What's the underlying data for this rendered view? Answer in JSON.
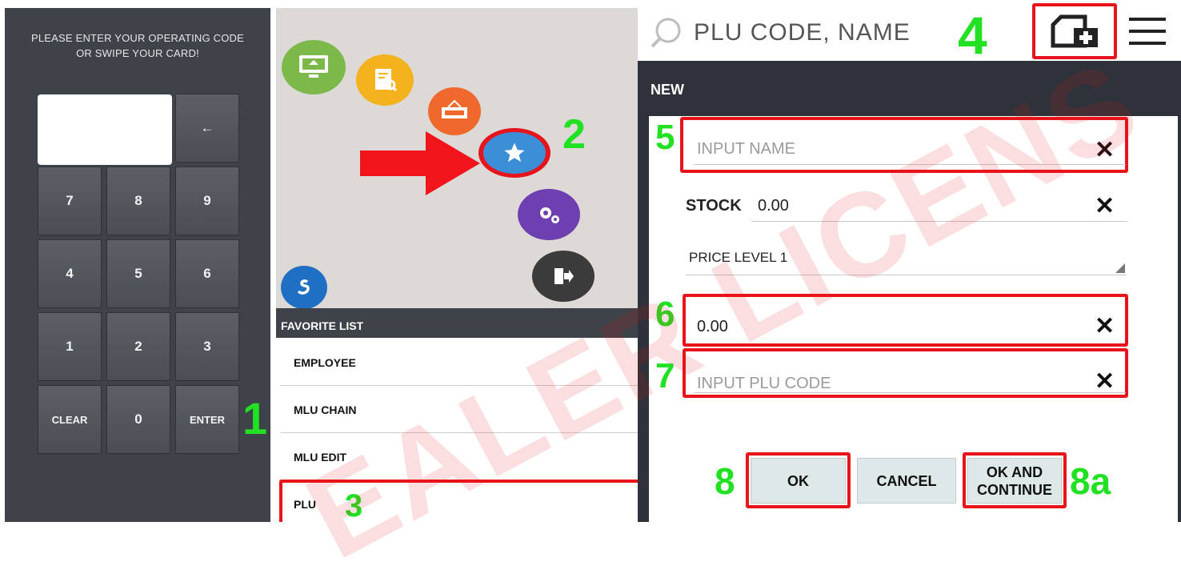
{
  "keypad": {
    "prompt_line1": "PLEASE ENTER YOUR OPERATING CODE",
    "prompt_line2": "OR SWIPE YOUR CARD!",
    "backspace": "←",
    "keys": [
      "7",
      "8",
      "9",
      "4",
      "5",
      "6",
      "1",
      "2",
      "3"
    ],
    "clear": "CLEAR",
    "zero": "0",
    "enter": "ENTER",
    "step": "1"
  },
  "menu": {
    "step": "2",
    "icons": [
      "monitor-icon",
      "receipt-search-icon",
      "open-sign-icon",
      "star-icon",
      "gear-icon",
      "exit-icon",
      "refresh-icon"
    ]
  },
  "favorites": {
    "header": "FAVORITE LIST",
    "items": [
      "EMPLOYEE",
      "MLU CHAIN",
      "MLU EDIT",
      "PLU"
    ],
    "step": "3"
  },
  "plu_form": {
    "search_placeholder": "PLU CODE, NAME",
    "step_add": "4",
    "title": "NEW",
    "name_placeholder": "INPUT NAME",
    "step_name": "5",
    "stock_label": "STOCK",
    "stock_value": "0.00",
    "price_level": "PRICE LEVEL 1",
    "price_value": "0.00",
    "step_price": "6",
    "plu_code_placeholder": "INPUT PLU CODE",
    "step_plu": "7",
    "ok": "OK",
    "cancel": "CANCEL",
    "ok_continue_line1": "OK AND",
    "ok_continue_line2": "CONTINUE",
    "step_ok": "8",
    "step_ok_continue": "8a",
    "clear_glyph": "✕"
  },
  "watermark": "EALER LICENS",
  "colors": {
    "highlight": "#e8141b",
    "step_number": "#22e022",
    "dark_panel": "#3e4249"
  }
}
